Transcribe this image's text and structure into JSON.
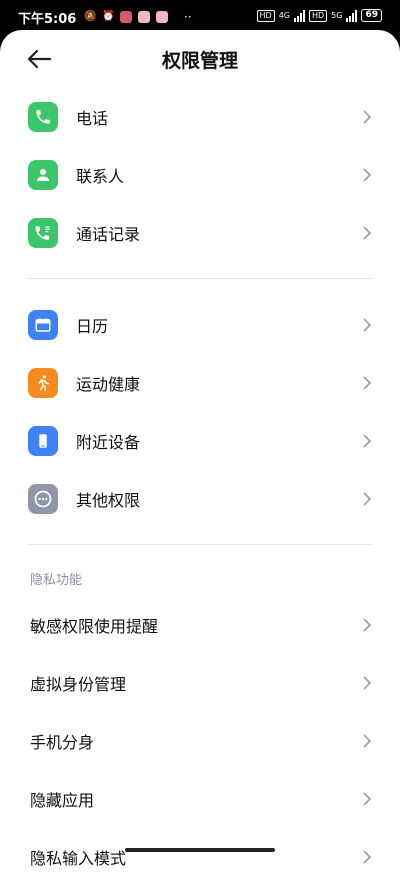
{
  "status_bar": {
    "time": "下午5:06",
    "network_labels": [
      "HD",
      "4G",
      "HD",
      "5G"
    ],
    "battery": "69"
  },
  "header": {
    "title": "权限管理"
  },
  "group1": [
    {
      "label": "电话",
      "icon": "phone-icon",
      "color": "#3cc56b"
    },
    {
      "label": "联系人",
      "icon": "contact-icon",
      "color": "#3cc56b"
    },
    {
      "label": "通话记录",
      "icon": "call-log-icon",
      "color": "#3cc56b"
    }
  ],
  "group2": [
    {
      "label": "日历",
      "icon": "calendar-icon",
      "color": "#3e82f7"
    },
    {
      "label": "运动健康",
      "icon": "running-icon",
      "color": "#f58a1f"
    },
    {
      "label": "附近设备",
      "icon": "device-icon",
      "color": "#3e82f7"
    },
    {
      "label": "其他权限",
      "icon": "more-icon",
      "color": "#8e96a8"
    }
  ],
  "privacy": {
    "section_title": "隐私功能",
    "items": [
      {
        "label": "敏感权限使用提醒"
      },
      {
        "label": "虚拟身份管理"
      },
      {
        "label": "手机分身"
      },
      {
        "label": "隐藏应用"
      },
      {
        "label": "隐私输入模式"
      }
    ]
  }
}
